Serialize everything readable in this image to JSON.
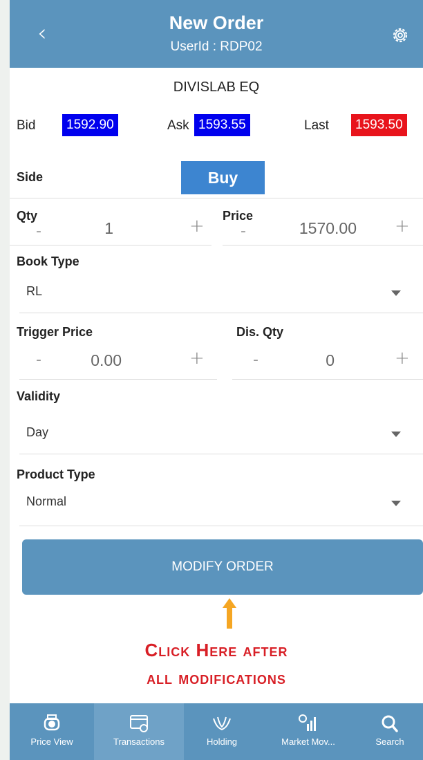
{
  "header": {
    "title": "New Order",
    "subtitle": "UserId : RDP02",
    "back_icon": "chevron-left-icon",
    "settings_icon": "gear-icon"
  },
  "instrument": {
    "symbol": "DIVISLAB EQ"
  },
  "quotes": {
    "bid_label": "Bid",
    "bid_value": "1592.90",
    "ask_label": "Ask",
    "ask_value": "1593.55",
    "last_label": "Last",
    "last_value": "1593.50",
    "colors": {
      "bid": "#0000ee",
      "ask": "#0000ee",
      "last": "#e8141c"
    }
  },
  "side": {
    "label": "Side",
    "value": "Buy"
  },
  "qty": {
    "label": "Qty",
    "minus": "-",
    "value": "1",
    "plus": "+"
  },
  "price": {
    "label": "Price",
    "minus": "-",
    "value": "1570.00",
    "plus": "+"
  },
  "book_type": {
    "label": "Book Type",
    "value": "RL"
  },
  "trigger_price": {
    "label": "Trigger Price",
    "minus": "-",
    "value": "0.00",
    "plus": "+"
  },
  "dis_qty": {
    "label": "Dis. Qty",
    "minus": "-",
    "value": "0",
    "plus": "+"
  },
  "validity": {
    "label": "Validity",
    "value": "Day"
  },
  "product_type": {
    "label": "Product Type",
    "value": "Normal"
  },
  "actions": {
    "modify_label": "MODIFY ORDER"
  },
  "annotation": {
    "line1": "Click Here after",
    "line2": "all modifications",
    "color": "#d81f26",
    "arrow_color": "#f5a623"
  },
  "tabbar": {
    "items": [
      {
        "label": "Price View",
        "icon": "price-view-icon"
      },
      {
        "label": "Transactions",
        "icon": "transactions-icon",
        "active": true
      },
      {
        "label": "Holding",
        "icon": "holding-icon"
      },
      {
        "label": "Market Mov...",
        "icon": "market-movers-icon"
      },
      {
        "label": "Search",
        "icon": "search-icon"
      }
    ]
  },
  "colors": {
    "primary": "#5b94bd",
    "buy": "#3d85d0"
  }
}
